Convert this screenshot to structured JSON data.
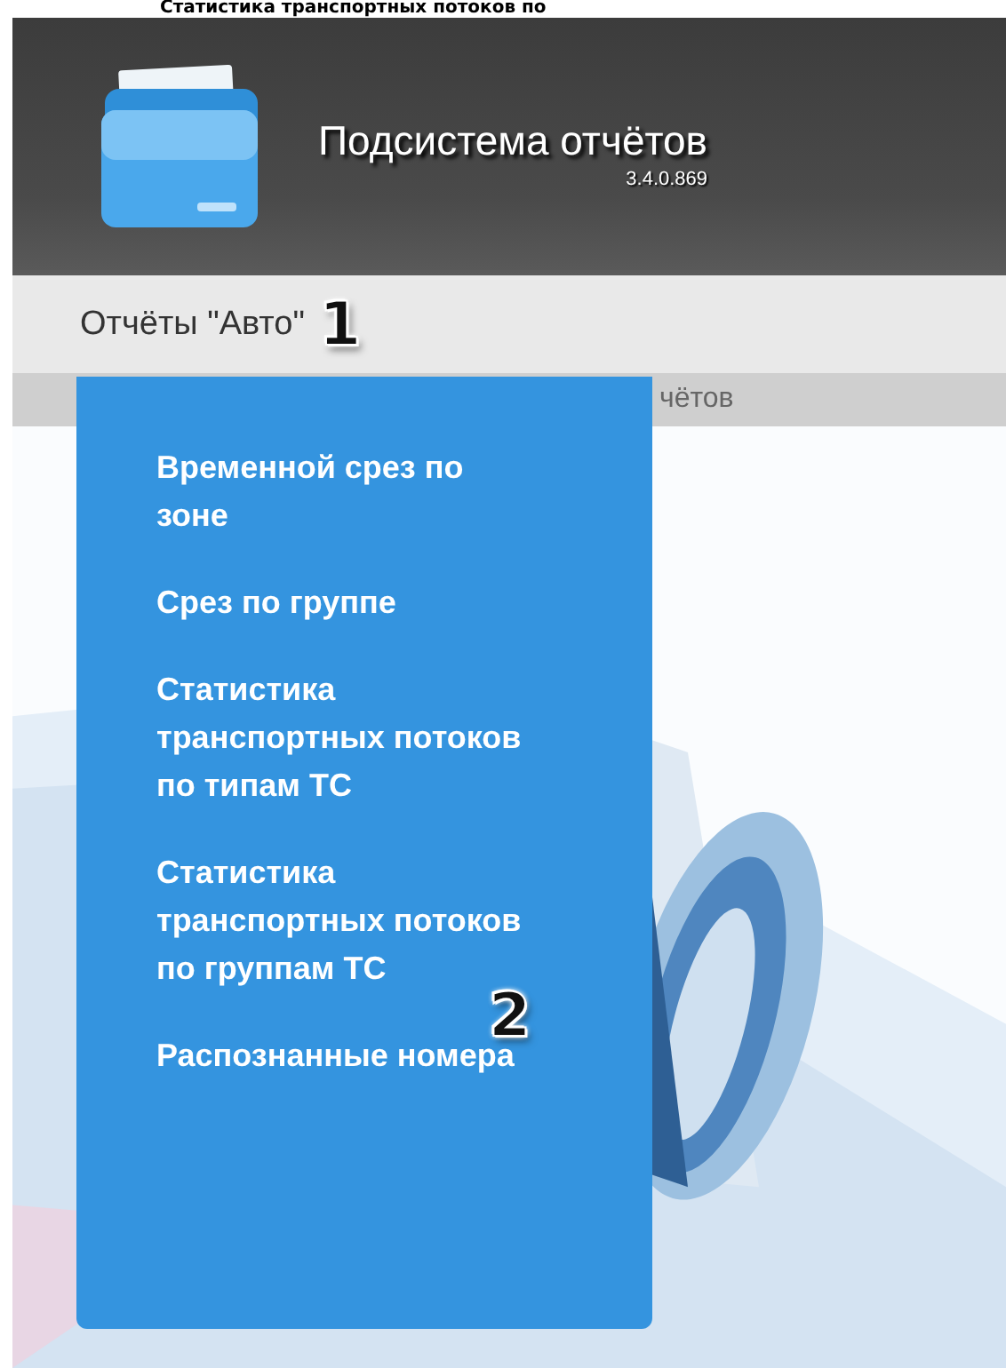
{
  "caption": "Статистика транспортных потоков по",
  "header": {
    "title": "Подсистема отчётов",
    "version": "3.4.0.869"
  },
  "nav": {
    "label": "Отчёты \"Авто\"",
    "expanded": true,
    "mark": "1"
  },
  "subbar": {
    "text": "чётов"
  },
  "menu": {
    "mark": "2",
    "items": [
      {
        "label": "Временной срез по зоне"
      },
      {
        "label": "Срез по группе"
      },
      {
        "label": "Статистика транспортных потоков по типам ТС"
      },
      {
        "label": "Статистика транспортных потоков по группам ТС"
      },
      {
        "label": "Распознанные номера"
      }
    ]
  }
}
